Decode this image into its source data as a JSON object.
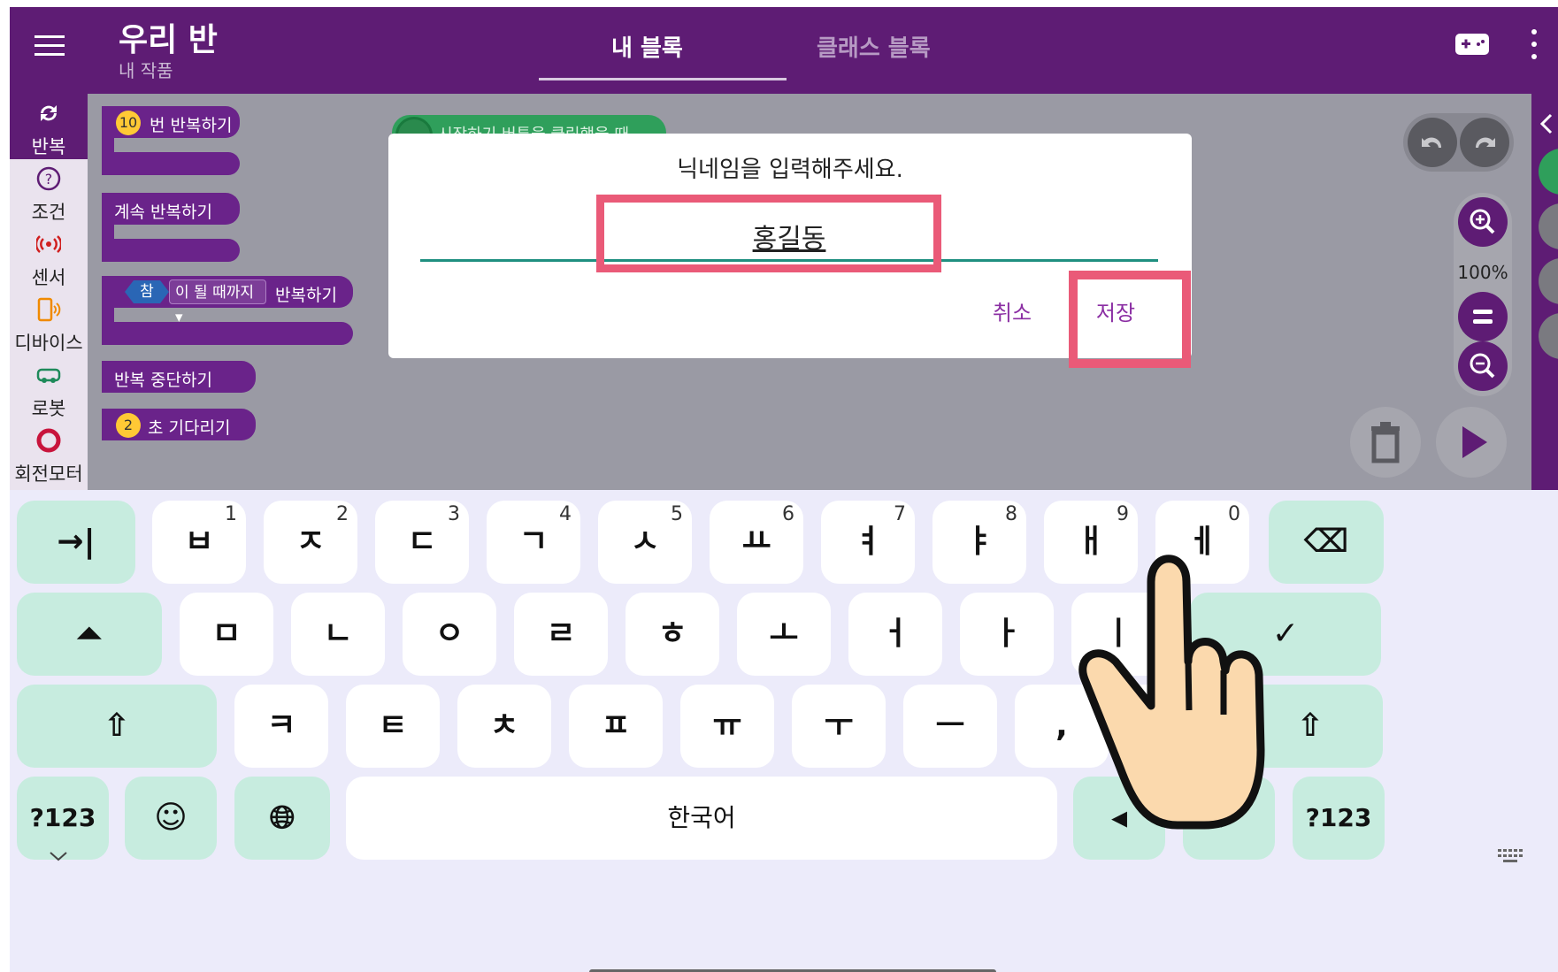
{
  "header": {
    "title": "우리 반",
    "subtitle": "내 작품",
    "tabs": [
      {
        "label": "내 블록",
        "active": true
      },
      {
        "label": "클래스 블록",
        "active": false
      }
    ]
  },
  "categories": [
    {
      "label": "반복",
      "icon": "loop-icon",
      "active": true
    },
    {
      "label": "조건",
      "icon": "question-icon"
    },
    {
      "label": "센서",
      "icon": "sensor-icon"
    },
    {
      "label": "디바이스",
      "icon": "device-icon"
    },
    {
      "label": "로봇",
      "icon": "robot-icon"
    },
    {
      "label": "회전모터",
      "icon": "rotation-motor-icon"
    }
  ],
  "blocks": {
    "repeat_n": {
      "count": "10",
      "label": "번 반복하기"
    },
    "repeat_forever": "계속 반복하기",
    "repeat_until": {
      "condition": "참",
      "dropdown": "이 될 때까지 ▾",
      "label": "반복하기"
    },
    "break": "반복 중단하기",
    "wait": {
      "count": "2",
      "label": "초 기다리기"
    }
  },
  "workspace": {
    "start_block_text": "시작하기 버튼을 클릭했을 때",
    "zoom_level": "100%"
  },
  "dialog": {
    "title": "닉네임을 입력해주세요.",
    "input_value": "홍길동",
    "cancel_label": "취소",
    "save_label": "저장"
  },
  "keyboard": {
    "row1": [
      {
        "label": "→|",
        "fn": true,
        "name": "tab-key"
      },
      {
        "label": "ㅂ",
        "sup": "1"
      },
      {
        "label": "ㅈ",
        "sup": "2"
      },
      {
        "label": "ㄷ",
        "sup": "3"
      },
      {
        "label": "ㄱ",
        "sup": "4"
      },
      {
        "label": "ㅅ",
        "sup": "5"
      },
      {
        "label": "ㅛ",
        "sup": "6"
      },
      {
        "label": "ㅕ",
        "sup": "7"
      },
      {
        "label": "ㅑ",
        "sup": "8"
      },
      {
        "label": "ㅐ",
        "sup": "9"
      },
      {
        "label": "ㅔ",
        "sup": "0"
      },
      {
        "label": "⌫",
        "fn": true,
        "name": "backspace-key"
      }
    ],
    "row2": [
      {
        "label": "⏶",
        "fn": true,
        "name": "caps-key"
      },
      {
        "label": "ㅁ"
      },
      {
        "label": "ㄴ"
      },
      {
        "label": "ㅇ"
      },
      {
        "label": "ㄹ"
      },
      {
        "label": "ㅎ"
      },
      {
        "label": "ㅗ"
      },
      {
        "label": "ㅓ"
      },
      {
        "label": "ㅏ"
      },
      {
        "label": "ㅣ"
      },
      {
        "label": "✓",
        "fn": true,
        "name": "enter-key"
      }
    ],
    "row3": [
      {
        "label": "⇧",
        "fn": true,
        "name": "shift-left-key"
      },
      {
        "label": "ㅋ"
      },
      {
        "label": "ㅌ"
      },
      {
        "label": "ㅊ"
      },
      {
        "label": "ㅍ"
      },
      {
        "label": "ㅠ"
      },
      {
        "label": "ㅜ"
      },
      {
        "label": "ㅡ"
      },
      {
        "label": ","
      },
      {
        "label": "."
      },
      {
        "label": "⇧",
        "fn": true,
        "name": "shift-right-key"
      }
    ],
    "row4": [
      {
        "label": "?123",
        "fn": true,
        "name": "symbols-left-key"
      },
      {
        "label": "☺",
        "fn": true,
        "name": "emoji-key"
      },
      {
        "label": "🌐︎",
        "fn": true,
        "name": "language-key"
      },
      {
        "label": "한국어",
        "name": "space-key"
      },
      {
        "label": "◂",
        "fn": true,
        "name": "cursor-left-key"
      },
      {
        "label": "▸",
        "fn": true,
        "name": "cursor-right-key"
      },
      {
        "label": "?123",
        "fn": true,
        "name": "symbols-right-key"
      }
    ],
    "collapse_icon": "chevron-down-icon",
    "keyboard_switch_icon": "keyboard-icon"
  },
  "colors": {
    "header": "#5e1c74",
    "block": "#6a238a",
    "highlight": "#ea5a78",
    "input_underline": "#1f8f80",
    "keyboard_fn_key": "#c7ecdf",
    "dialog_button": "#8b2ea3"
  }
}
